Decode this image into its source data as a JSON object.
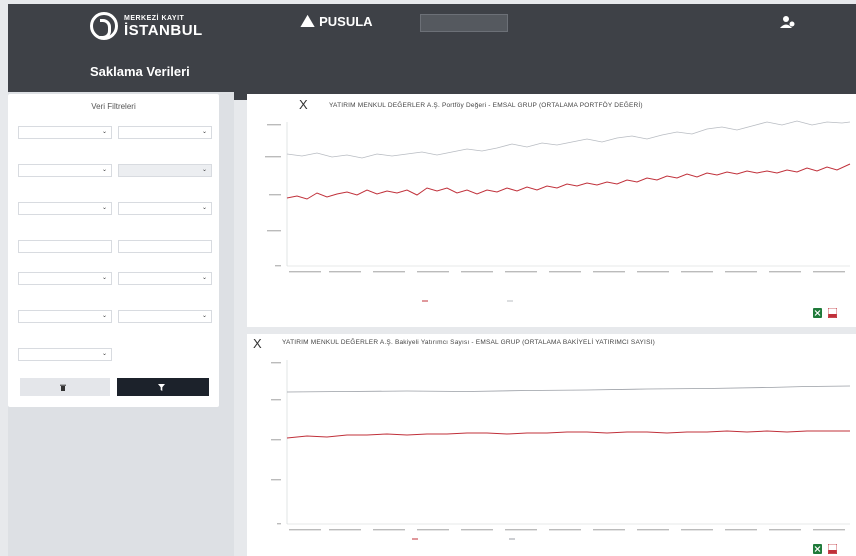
{
  "header": {
    "logo1_top": "MERKEZİ KAYIT",
    "logo1_main": "İSTANBUL",
    "logo1_sub": "",
    "logo2_name": "PUSULA",
    "logo2_tag": "",
    "nav_button": "",
    "welcome": "",
    "page_title": "Saklama Verileri"
  },
  "filters": {
    "title": "Veri Filtreleri",
    "fields": [
      {
        "label": "",
        "value": ""
      },
      {
        "label": "",
        "value": ""
      },
      {
        "label": "",
        "value": ""
      },
      {
        "label": "",
        "value": ""
      },
      {
        "label": "",
        "value": ""
      },
      {
        "label": "",
        "value": ""
      },
      {
        "label": "",
        "value": ""
      },
      {
        "label": "",
        "value": ""
      },
      {
        "label": "",
        "value": ""
      },
      {
        "label": "",
        "value": ""
      },
      {
        "label": "",
        "value": ""
      },
      {
        "label": "",
        "value": ""
      },
      {
        "label": "",
        "value": ""
      }
    ],
    "clear_button": "",
    "filter_button": ""
  },
  "charts": [
    {
      "close": "X",
      "title": "YATIRIM MENKUL DEĞERLER A.Ş. Portföy Değeri - EMSAL GRUP (ORTALAMA PORTFÖY DEĞERİ)",
      "legend_left": "",
      "legend_right": ""
    },
    {
      "close": "X",
      "title": "YATIRIM MENKUL DEĞERLER A.Ş. Bakiyeli Yatırımcı Sayısı - EMSAL GRUP (ORTALAMA BAKİYELİ YATIRIMCI SAYISI)",
      "legend_left": "",
      "legend_right": ""
    }
  ],
  "colors": {
    "header_bg": "#3e4147",
    "accent_red": "#c0303a",
    "series_grey": "#b8bcc2",
    "filter_button_bg": "#1c222b"
  },
  "icons": [
    "excel-icon",
    "pdf-icon",
    "user-icon",
    "trash-icon",
    "filter-icon"
  ]
}
